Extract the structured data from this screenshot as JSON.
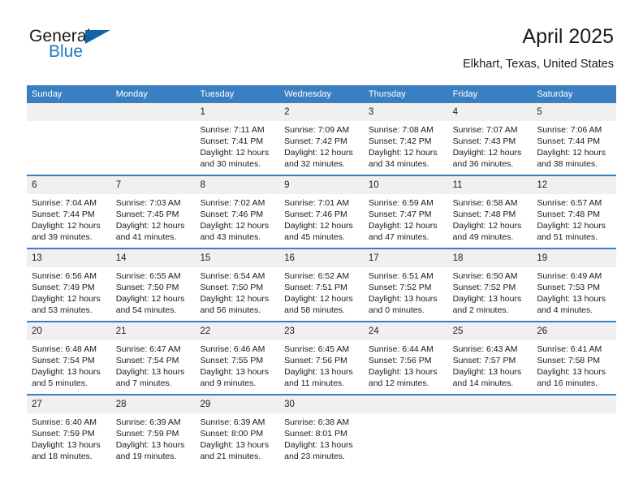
{
  "brand": {
    "name_part1": "General",
    "name_part2": "Blue",
    "triangle_icon": "triangle-icon",
    "accent_color": "#1f7ac0",
    "logo_mark_color": "#1464a5"
  },
  "header": {
    "title": "April 2025",
    "subtitle": "Elkhart, Texas, United States"
  },
  "theme": {
    "header_row_bg": "#3a7fc1",
    "daynum_band_bg": "#f0f0f0",
    "cell_bg": "#ffffff",
    "text_color": "#1a1a1a"
  },
  "weekdays": [
    "Sunday",
    "Monday",
    "Tuesday",
    "Wednesday",
    "Thursday",
    "Friday",
    "Saturday"
  ],
  "weeks": [
    {
      "days": [
        {
          "num": "",
          "empty": true,
          "l1": "",
          "l2": "",
          "l3": "",
          "l4": ""
        },
        {
          "num": "",
          "empty": true,
          "l1": "",
          "l2": "",
          "l3": "",
          "l4": ""
        },
        {
          "num": "1",
          "empty": false,
          "l1": "Sunrise: 7:11 AM",
          "l2": "Sunset: 7:41 PM",
          "l3": "Daylight: 12 hours",
          "l4": "and 30 minutes."
        },
        {
          "num": "2",
          "empty": false,
          "l1": "Sunrise: 7:09 AM",
          "l2": "Sunset: 7:42 PM",
          "l3": "Daylight: 12 hours",
          "l4": "and 32 minutes."
        },
        {
          "num": "3",
          "empty": false,
          "l1": "Sunrise: 7:08 AM",
          "l2": "Sunset: 7:42 PM",
          "l3": "Daylight: 12 hours",
          "l4": "and 34 minutes."
        },
        {
          "num": "4",
          "empty": false,
          "l1": "Sunrise: 7:07 AM",
          "l2": "Sunset: 7:43 PM",
          "l3": "Daylight: 12 hours",
          "l4": "and 36 minutes."
        },
        {
          "num": "5",
          "empty": false,
          "l1": "Sunrise: 7:06 AM",
          "l2": "Sunset: 7:44 PM",
          "l3": "Daylight: 12 hours",
          "l4": "and 38 minutes."
        }
      ]
    },
    {
      "days": [
        {
          "num": "6",
          "empty": false,
          "l1": "Sunrise: 7:04 AM",
          "l2": "Sunset: 7:44 PM",
          "l3": "Daylight: 12 hours",
          "l4": "and 39 minutes."
        },
        {
          "num": "7",
          "empty": false,
          "l1": "Sunrise: 7:03 AM",
          "l2": "Sunset: 7:45 PM",
          "l3": "Daylight: 12 hours",
          "l4": "and 41 minutes."
        },
        {
          "num": "8",
          "empty": false,
          "l1": "Sunrise: 7:02 AM",
          "l2": "Sunset: 7:46 PM",
          "l3": "Daylight: 12 hours",
          "l4": "and 43 minutes."
        },
        {
          "num": "9",
          "empty": false,
          "l1": "Sunrise: 7:01 AM",
          "l2": "Sunset: 7:46 PM",
          "l3": "Daylight: 12 hours",
          "l4": "and 45 minutes."
        },
        {
          "num": "10",
          "empty": false,
          "l1": "Sunrise: 6:59 AM",
          "l2": "Sunset: 7:47 PM",
          "l3": "Daylight: 12 hours",
          "l4": "and 47 minutes."
        },
        {
          "num": "11",
          "empty": false,
          "l1": "Sunrise: 6:58 AM",
          "l2": "Sunset: 7:48 PM",
          "l3": "Daylight: 12 hours",
          "l4": "and 49 minutes."
        },
        {
          "num": "12",
          "empty": false,
          "l1": "Sunrise: 6:57 AM",
          "l2": "Sunset: 7:48 PM",
          "l3": "Daylight: 12 hours",
          "l4": "and 51 minutes."
        }
      ]
    },
    {
      "days": [
        {
          "num": "13",
          "empty": false,
          "l1": "Sunrise: 6:56 AM",
          "l2": "Sunset: 7:49 PM",
          "l3": "Daylight: 12 hours",
          "l4": "and 53 minutes."
        },
        {
          "num": "14",
          "empty": false,
          "l1": "Sunrise: 6:55 AM",
          "l2": "Sunset: 7:50 PM",
          "l3": "Daylight: 12 hours",
          "l4": "and 54 minutes."
        },
        {
          "num": "15",
          "empty": false,
          "l1": "Sunrise: 6:54 AM",
          "l2": "Sunset: 7:50 PM",
          "l3": "Daylight: 12 hours",
          "l4": "and 56 minutes."
        },
        {
          "num": "16",
          "empty": false,
          "l1": "Sunrise: 6:52 AM",
          "l2": "Sunset: 7:51 PM",
          "l3": "Daylight: 12 hours",
          "l4": "and 58 minutes."
        },
        {
          "num": "17",
          "empty": false,
          "l1": "Sunrise: 6:51 AM",
          "l2": "Sunset: 7:52 PM",
          "l3": "Daylight: 13 hours",
          "l4": "and 0 minutes."
        },
        {
          "num": "18",
          "empty": false,
          "l1": "Sunrise: 6:50 AM",
          "l2": "Sunset: 7:52 PM",
          "l3": "Daylight: 13 hours",
          "l4": "and 2 minutes."
        },
        {
          "num": "19",
          "empty": false,
          "l1": "Sunrise: 6:49 AM",
          "l2": "Sunset: 7:53 PM",
          "l3": "Daylight: 13 hours",
          "l4": "and 4 minutes."
        }
      ]
    },
    {
      "days": [
        {
          "num": "20",
          "empty": false,
          "l1": "Sunrise: 6:48 AM",
          "l2": "Sunset: 7:54 PM",
          "l3": "Daylight: 13 hours",
          "l4": "and 5 minutes."
        },
        {
          "num": "21",
          "empty": false,
          "l1": "Sunrise: 6:47 AM",
          "l2": "Sunset: 7:54 PM",
          "l3": "Daylight: 13 hours",
          "l4": "and 7 minutes."
        },
        {
          "num": "22",
          "empty": false,
          "l1": "Sunrise: 6:46 AM",
          "l2": "Sunset: 7:55 PM",
          "l3": "Daylight: 13 hours",
          "l4": "and 9 minutes."
        },
        {
          "num": "23",
          "empty": false,
          "l1": "Sunrise: 6:45 AM",
          "l2": "Sunset: 7:56 PM",
          "l3": "Daylight: 13 hours",
          "l4": "and 11 minutes."
        },
        {
          "num": "24",
          "empty": false,
          "l1": "Sunrise: 6:44 AM",
          "l2": "Sunset: 7:56 PM",
          "l3": "Daylight: 13 hours",
          "l4": "and 12 minutes."
        },
        {
          "num": "25",
          "empty": false,
          "l1": "Sunrise: 6:43 AM",
          "l2": "Sunset: 7:57 PM",
          "l3": "Daylight: 13 hours",
          "l4": "and 14 minutes."
        },
        {
          "num": "26",
          "empty": false,
          "l1": "Sunrise: 6:41 AM",
          "l2": "Sunset: 7:58 PM",
          "l3": "Daylight: 13 hours",
          "l4": "and 16 minutes."
        }
      ]
    },
    {
      "days": [
        {
          "num": "27",
          "empty": false,
          "l1": "Sunrise: 6:40 AM",
          "l2": "Sunset: 7:59 PM",
          "l3": "Daylight: 13 hours",
          "l4": "and 18 minutes."
        },
        {
          "num": "28",
          "empty": false,
          "l1": "Sunrise: 6:39 AM",
          "l2": "Sunset: 7:59 PM",
          "l3": "Daylight: 13 hours",
          "l4": "and 19 minutes."
        },
        {
          "num": "29",
          "empty": false,
          "l1": "Sunrise: 6:39 AM",
          "l2": "Sunset: 8:00 PM",
          "l3": "Daylight: 13 hours",
          "l4": "and 21 minutes."
        },
        {
          "num": "30",
          "empty": false,
          "l1": "Sunrise: 6:38 AM",
          "l2": "Sunset: 8:01 PM",
          "l3": "Daylight: 13 hours",
          "l4": "and 23 minutes."
        },
        {
          "num": "",
          "empty": true,
          "l1": "",
          "l2": "",
          "l3": "",
          "l4": ""
        },
        {
          "num": "",
          "empty": true,
          "l1": "",
          "l2": "",
          "l3": "",
          "l4": ""
        },
        {
          "num": "",
          "empty": true,
          "l1": "",
          "l2": "",
          "l3": "",
          "l4": ""
        }
      ]
    }
  ]
}
